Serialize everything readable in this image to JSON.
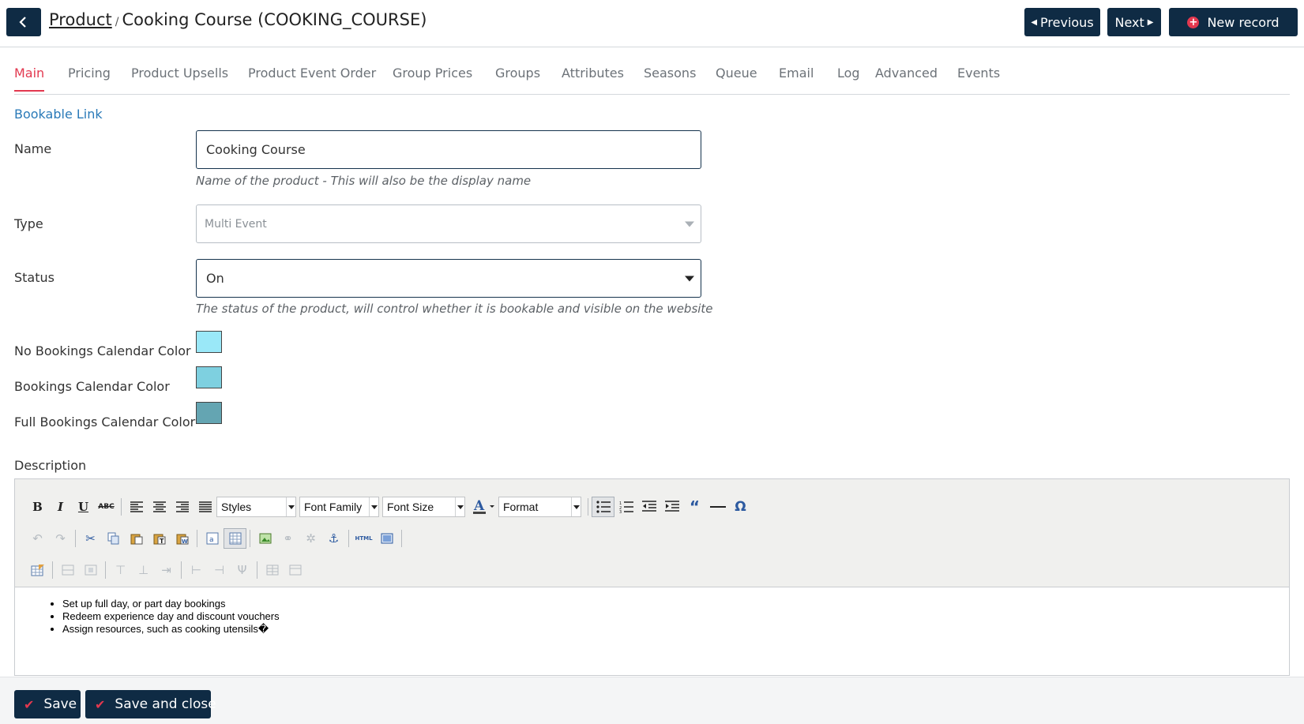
{
  "header": {
    "breadcrumb_parent": "Product",
    "breadcrumb_separator": "/",
    "title": "Cooking Course (COOKING_COURSE)",
    "previous_label": "Previous",
    "next_label": "Next",
    "new_record_label": "New record"
  },
  "tabs": [
    {
      "label": "Main",
      "active": true
    },
    {
      "label": "Pricing"
    },
    {
      "label": "Product Upsells"
    },
    {
      "label": "Product Event Order"
    },
    {
      "label": "Group Prices"
    },
    {
      "label": "Groups"
    },
    {
      "label": "Attributes"
    },
    {
      "label": "Seasons"
    },
    {
      "label": "Queue"
    },
    {
      "label": "Email"
    },
    {
      "label": "Log"
    },
    {
      "label": "Advanced"
    },
    {
      "label": "Events"
    }
  ],
  "form": {
    "bookable_link": "Bookable Link",
    "name": {
      "label": "Name",
      "value": "Cooking Course",
      "help": "Name of the product - This will also be the display name"
    },
    "type": {
      "label": "Type",
      "value": "Multi Event"
    },
    "status": {
      "label": "Status",
      "value": "On",
      "help": "The status of the product, will control whether it is bookable and visible on the website"
    },
    "colors": [
      {
        "label": "No Bookings Calendar Color",
        "color": "#9ae8f8"
      },
      {
        "label": "Bookings Calendar Color",
        "color": "#7ed0e0"
      },
      {
        "label": "Full Bookings Calendar Color",
        "color": "#64a5b2"
      }
    ],
    "description_label": "Description"
  },
  "editor": {
    "styles_label": "Styles",
    "font_family_label": "Font Family",
    "font_size_label": "Font Size",
    "format_label": "Format",
    "content": [
      "Set up full day, or part day bookings",
      "Redeem experience day and discount vouchers",
      "Assign resources, such as cooking utensils�"
    ]
  },
  "footer": {
    "save_label": "Save",
    "save_close_label": "Save and close"
  },
  "colors": {
    "navy": "#0f2b44",
    "accent": "#e2384f",
    "link": "#2a7ab8"
  }
}
